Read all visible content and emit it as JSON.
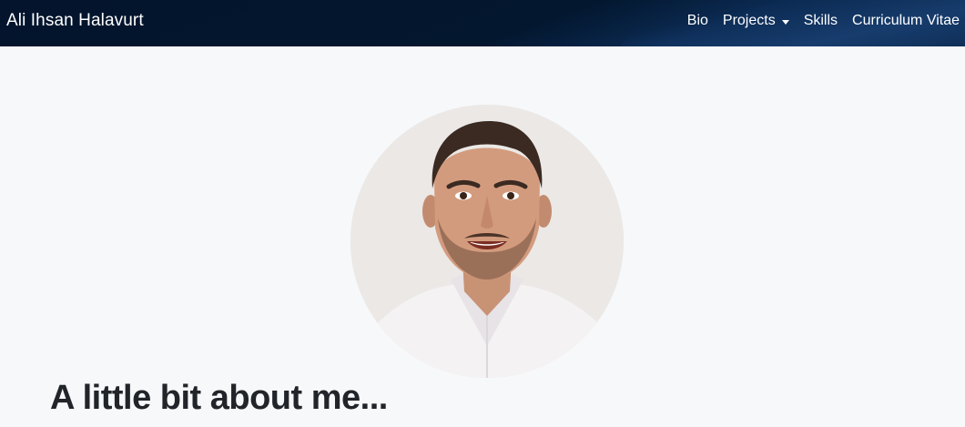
{
  "navbar": {
    "brand": "Ali Ihsan Halavurt",
    "links": [
      {
        "label": "Bio"
      },
      {
        "label": "Projects",
        "dropdown": true
      },
      {
        "label": "Skills"
      },
      {
        "label": "Curriculum Vitae"
      }
    ]
  },
  "main": {
    "avatar_alt": "portrait-photo",
    "heading": "A little bit about me..."
  },
  "colors": {
    "navbar_bg": "#03172f",
    "page_bg": "#f7f8fa",
    "heading": "#212529"
  }
}
